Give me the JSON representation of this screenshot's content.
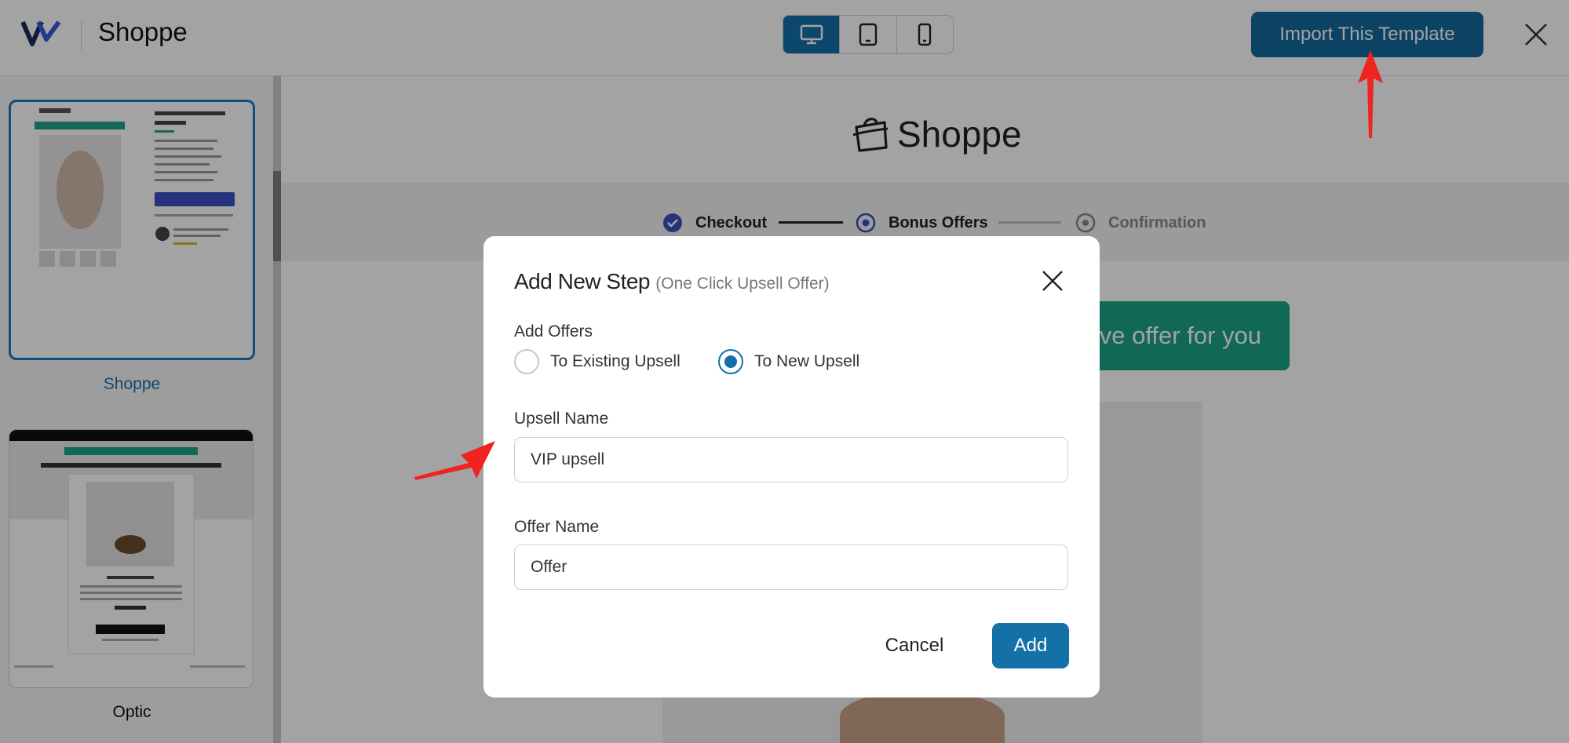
{
  "app": {
    "title": "Shoppe"
  },
  "toolbar": {
    "import_label": "Import This Template",
    "devices": [
      "desktop-icon",
      "tablet-icon",
      "mobile-icon"
    ],
    "active_device": "desktop"
  },
  "sidebar": {
    "templates": [
      {
        "label": "Shoppe",
        "selected": true
      },
      {
        "label": "Optic",
        "selected": false
      }
    ]
  },
  "preview": {
    "brand": "Shoppe",
    "steps": [
      {
        "label": "Checkout",
        "state": "done"
      },
      {
        "label": "Bonus Offers",
        "state": "current"
      },
      {
        "label": "Confirmation",
        "state": "upcoming"
      }
    ],
    "banner_text": "sive offer for you"
  },
  "modal": {
    "title": "Add New Step",
    "subtitle": "(One Click Upsell Offer)",
    "add_offers_label": "Add Offers",
    "radio_existing": "To Existing Upsell",
    "radio_new": "To New Upsell",
    "selected_radio": "To New Upsell",
    "upsell_name_label": "Upsell Name",
    "upsell_name_value": "VIP upsell",
    "offer_name_label": "Offer Name",
    "offer_name_value": "Offer",
    "cancel_label": "Cancel",
    "add_label": "Add"
  },
  "colors": {
    "accent": "#1371a8",
    "banner": "#1aa386",
    "annotation_arrow": "#f0231f"
  }
}
